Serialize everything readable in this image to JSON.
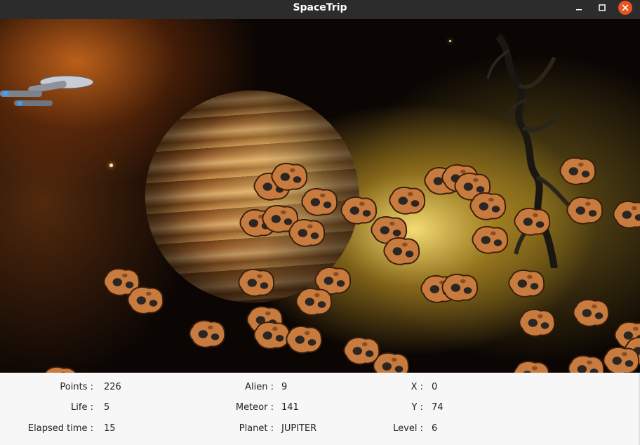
{
  "window": {
    "title": "SpaceTrip"
  },
  "colors": {
    "close_button": "#e95420",
    "titlebar": "#2c2c2c",
    "panel": "#f7f7f7"
  },
  "icons": [
    "minimize-icon",
    "maximize-icon",
    "close-icon",
    "spaceship-icon",
    "meteor-icon",
    "alien-icon",
    "planet-icon"
  ],
  "stats": {
    "points_label": "Points :",
    "points_value": "226",
    "life_label": "Life :",
    "life_value": "5",
    "elapsed_label": "Elapsed time :",
    "elapsed_value": "15",
    "alien_label": "Alien :",
    "alien_value": "9",
    "meteor_label": "Meteor :",
    "meteor_value": "141",
    "planet_label": "Planet :",
    "planet_value": "JUPITER",
    "x_label": "X :",
    "x_value": "0",
    "y_label": "Y :",
    "y_value": "74",
    "level_label": "Level :",
    "level_value": "6"
  }
}
